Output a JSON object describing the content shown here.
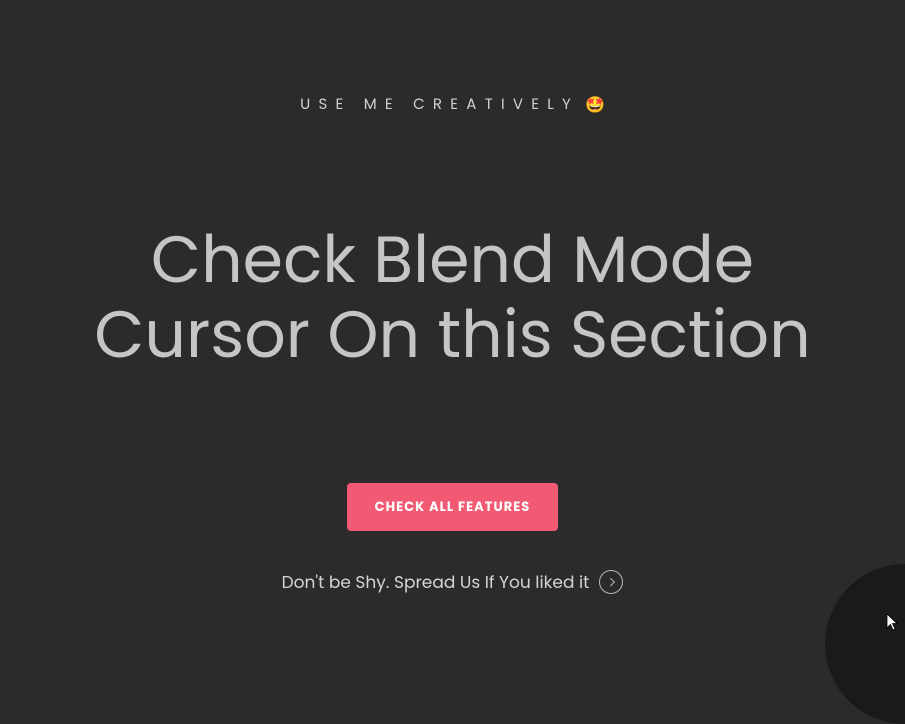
{
  "hero": {
    "eyebrow_text": "USE ME CREATIVELY",
    "eyebrow_emoji": "🤩",
    "headline": "Check Blend Mode Cursor On this Section",
    "cta_label": "CHECK ALL FEATURES",
    "tagline": "Don't be Shy. Spread Us If You liked it"
  },
  "colors": {
    "background": "#2b2b2b",
    "text": "#c5c5c5",
    "accent": "#f15a72"
  }
}
